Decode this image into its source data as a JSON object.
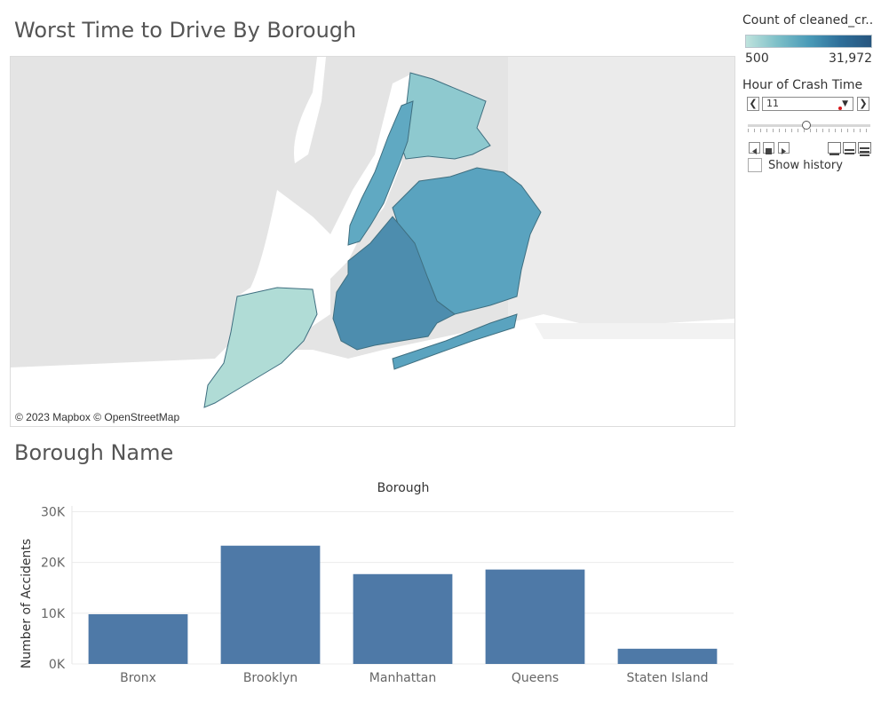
{
  "map": {
    "title": "Worst Time to Drive By Borough",
    "attribution": "© 2023 Mapbox © OpenStreetMap",
    "colors": {
      "bronx": "#8ec9cf",
      "manhattan": "#60a9c2",
      "queens": "#5aa3bf",
      "brooklyn": "#4d8dae",
      "staten_island": "#b0dcd6",
      "water": "#ffffff",
      "land": "#e6e6e6"
    }
  },
  "legend": {
    "title": "Count of cleaned_cr..",
    "min": "500",
    "max": "31,972",
    "ramp_colors": [
      "#bfe3dd",
      "#27557e"
    ]
  },
  "filter": {
    "title": "Hour of Crash Time",
    "value": "11",
    "prev_icon": "chevron-left-icon",
    "next_icon": "chevron-right-icon",
    "show_history_label": "Show history",
    "show_history_checked": false
  },
  "bar_panel": {
    "title": "Borough Name"
  },
  "chart_data": {
    "type": "bar",
    "title": "Borough",
    "xlabel": "",
    "ylabel": "Number of Accidents",
    "categories": [
      "Bronx",
      "Brooklyn",
      "Manhattan",
      "Queens",
      "Staten Island"
    ],
    "values": [
      9800,
      23300,
      17700,
      18600,
      3000
    ],
    "ylim": [
      0,
      32000
    ],
    "yticks": [
      0,
      10000,
      20000,
      30000
    ],
    "ytick_labels": [
      "0K",
      "10K",
      "20K",
      "30K"
    ],
    "bar_color": "#4e79a7",
    "grid": true
  }
}
